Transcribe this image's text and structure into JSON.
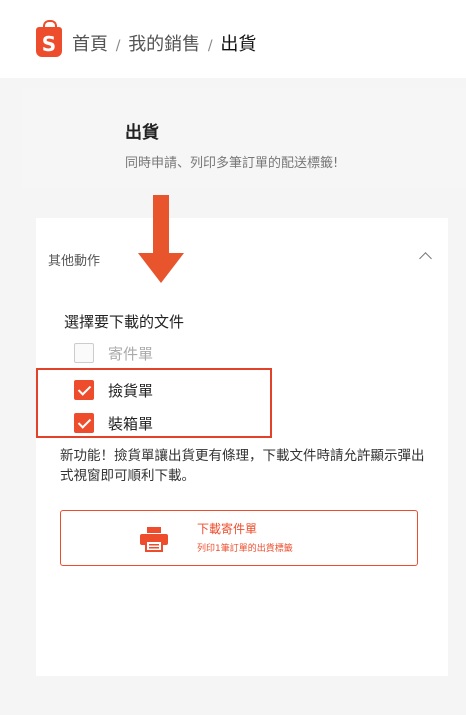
{
  "breadcrumb": {
    "home": "首頁",
    "sep1": "/",
    "my_sales": "我的銷售",
    "sep2": "/",
    "current": "出貨"
  },
  "header": {
    "title": "出貨",
    "subtitle": "同時申請、列印多筆訂單的配送標籤!"
  },
  "panel": {
    "more_actions": "其他動作",
    "section_title": "選擇要下載的文件",
    "options": [
      {
        "label": "寄件單",
        "checked": false,
        "disabled": true
      },
      {
        "label": "撿貨單",
        "checked": true,
        "disabled": false
      },
      {
        "label": "裝箱單",
        "checked": true,
        "disabled": false
      }
    ],
    "notice": "新功能！撿貨單讓出貨更有條理，下載文件時請允許顯示彈出式視窗即可順利下載。",
    "download_button": {
      "label": "下載寄件單",
      "sublabel": "列印1筆訂單的出貨標籤"
    }
  },
  "colors": {
    "brand": "#ee4d2d",
    "annotation": "#e2412a"
  }
}
